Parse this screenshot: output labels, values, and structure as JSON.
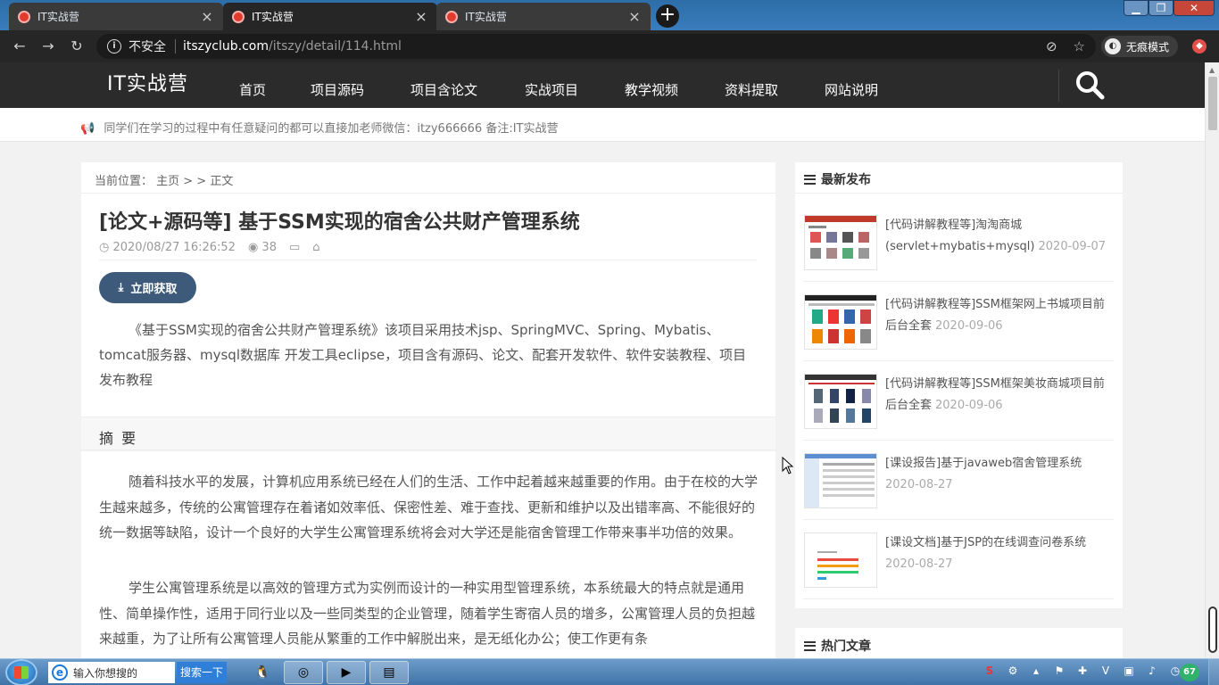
{
  "browser": {
    "tabs": [
      {
        "title": "IT实战营",
        "close": "×"
      },
      {
        "title": "IT实战营",
        "close": "×"
      },
      {
        "title": "IT实战营",
        "close": "×"
      }
    ],
    "new_tab": "+",
    "security_label": "不安全",
    "url_domain": "itszyclub.com",
    "url_path": "/itszy/detail/114.html",
    "incognito_label": "无痕模式"
  },
  "site": {
    "logo": "IT实战营",
    "nav": [
      "首页",
      "项目源码",
      "项目含论文",
      "实战项目",
      "教学视频",
      "资料提取",
      "网站说明"
    ],
    "notice": "同学们在学习的过程中有任意疑问的都可以直接加老师微信：itzy666666 备注:IT实战营"
  },
  "article": {
    "breadcrumb": "当前位置： 主页 > > 正文",
    "title": "[论文+源码等] 基于SSM实现的宿舍公共财产管理系统",
    "date": "2020/08/27 16:26:52",
    "views": "38",
    "get_button": "立即获取",
    "intro": "《基于SSM实现的宿舍公共财产管理系统》该项目采用技术jsp、SpringMVC、Spring、Mybatis、tomcat服务器、mysql数据库 开发工具eclipse，项目含有源码、论文、配套开发软件、软件安装教程、项目发布教程",
    "abstract_heading": "摘 要",
    "para1": "随着科技水平的发展，计算机应用系统已经在人们的生活、工作中起着越来越重要的作用。由于在校的大学生越来越多，传统的公寓管理存在着诸如效率低、保密性差、难于查找、更新和维护以及出错率高、不能很好的统一数据等缺陷，设计一个良好的大学生公寓管理系统将会对大学还是能宿舍管理工作带来事半功倍的效果。",
    "para2": "学生公寓管理系统是以高效的管理方式为实例而设计的一种实用型管理系统，本系统最大的特点就是通用性、简单操作性，适用于同行业以及一些同类型的企业管理，随着学生寄宿人员的增多，公寓管理人员的负担越来越重，为了让所有公寓管理人员能从繁重的工作中解脱出来，是无纸化办公；使工作更有条"
  },
  "sidebar": {
    "latest_heading": "最新发布",
    "hot_heading": "热门文章",
    "posts": [
      {
        "title": "[代码讲解教程等]淘淘商城(servlet+mybatis+mysql)",
        "date": "2020-09-07"
      },
      {
        "title": "[代码讲解教程等]SSM框架网上书城项目前后台全套",
        "date": "2020-09-06"
      },
      {
        "title": "[代码讲解教程等]SSM框架美妆商城项目前后台全套",
        "date": "2020-09-06"
      },
      {
        "title": "[课设报告]基于javaweb宿舍管理系统",
        "date": "2020-08-27"
      },
      {
        "title": "[课设文档]基于JSP的在线调查问卷系统",
        "date": "2020-08-27"
      }
    ]
  },
  "taskbar": {
    "search_placeholder": "输入你想搜的",
    "search_button": "搜索一下",
    "cpu_label": "67"
  },
  "icons": [
    "back-icon",
    "forward-icon",
    "reload-icon",
    "info-icon",
    "eye-off-icon",
    "star-icon",
    "incognito-icon",
    "search-icon",
    "megaphone-icon",
    "clock-icon",
    "eye-icon",
    "folder-icon",
    "tags-icon",
    "download-icon",
    "list-icon"
  ],
  "colors": {
    "tab_bar": "#3a7dbd",
    "header": "#2b2b2b",
    "button": "#3d5a7a",
    "taskbar": "#4f82b6"
  }
}
